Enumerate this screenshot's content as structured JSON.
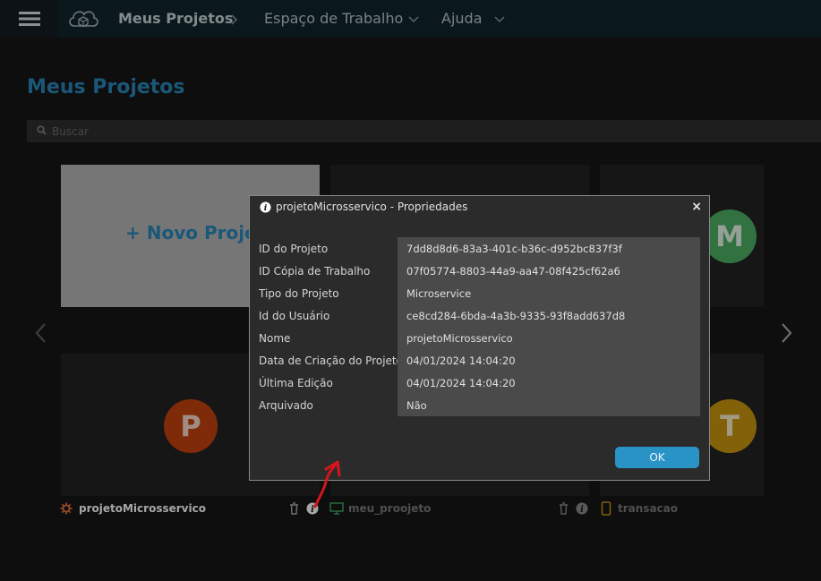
{
  "topbar": {
    "nav": [
      {
        "label": "Meus Projetos"
      },
      {
        "label": "Espaço de Trabalho"
      },
      {
        "label": "Ajuda"
      }
    ],
    "icons": {
      "menu": "hamburger-icon",
      "logo": "cloud-cube-logo",
      "separator": "chevron-right-icon",
      "dropdown": "chevron-down-icon"
    }
  },
  "page": {
    "title": "Meus Projetos",
    "search_placeholder": "Buscar"
  },
  "cards": {
    "new_project_label": "+ Novo Projeto",
    "avatars": [
      {
        "letter": "M",
        "color": "#4caf63"
      },
      {
        "letter": "P",
        "color": "#c4420f"
      },
      {
        "letter": "T",
        "color": "#c8960f"
      }
    ]
  },
  "projects": [
    {
      "name": "projetoMicrosservico",
      "icon": "gear-icon",
      "color": "#ffffff",
      "accent": "#e0733a"
    },
    {
      "name": "meu_proojeto",
      "icon": "monitor-icon",
      "color": "#7a7a7a",
      "accent": "#3fa060"
    },
    {
      "name": "transacao",
      "icon": "phone-icon",
      "color": "#7a7a7a",
      "accent": "#c8960f"
    }
  ],
  "dialog": {
    "title": "projetoMicrosservico - Propriedades",
    "properties": [
      {
        "label": "ID do Projeto",
        "value": "7dd8d8d6-83a3-401c-b36c-d952bc837f3f"
      },
      {
        "label": "ID Cópia de Trabalho",
        "value": "07f05774-8803-44a9-aa47-08f425cf62a6"
      },
      {
        "label": "Tipo do Projeto",
        "value": "Microservice"
      },
      {
        "label": "Id do Usuário",
        "value": "ce8cd284-6bda-4a3b-9335-93f8add637d8"
      },
      {
        "label": "Nome",
        "value": "projetoMicrosservico"
      },
      {
        "label": "Data de Criação do Projeto",
        "value": "04/01/2024 14:04:20"
      },
      {
        "label": "Última Edição",
        "value": "04/01/2024 14:04:20"
      },
      {
        "label": "Arquivado",
        "value": "Não"
      }
    ],
    "ok_label": "OK",
    "close_symbol": "×"
  },
  "colors": {
    "accent": "#2a86b8",
    "button": "#2a93c6",
    "annotation": "#d4161c"
  }
}
